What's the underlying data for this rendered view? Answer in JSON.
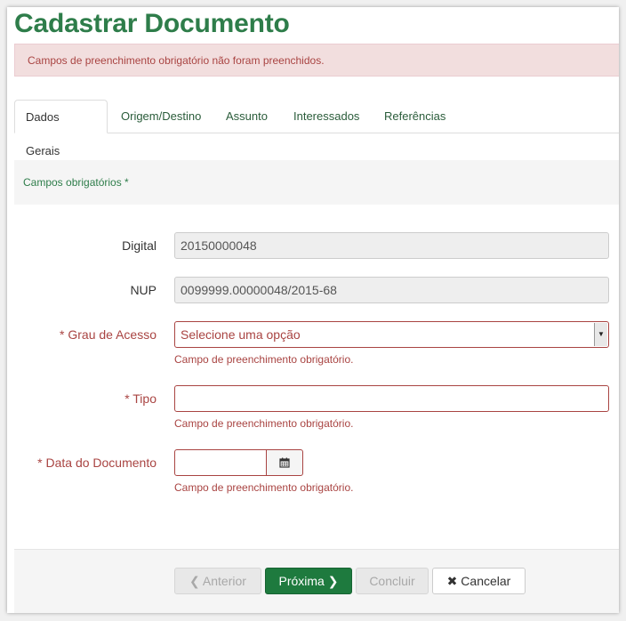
{
  "page": {
    "title": "Cadastrar Documento",
    "alert": "Campos de preenchimento obrigatório não foram preenchidos."
  },
  "tabs": [
    {
      "label": "Dados Gerais",
      "active": true
    },
    {
      "label": "Origem/Destino"
    },
    {
      "label": "Assunto"
    },
    {
      "label": "Interessados"
    },
    {
      "label": "Referências"
    }
  ],
  "panel": {
    "required_note": "Campos obrigatórios *"
  },
  "form": {
    "digital": {
      "label": "Digital",
      "value": "20150000048"
    },
    "nup": {
      "label": "NUP",
      "value": "0099999.00000048/2015-68"
    },
    "grau_acesso": {
      "label": "* Grau de Acesso",
      "selected": "Selecione uma opção",
      "error": "Campo de preenchimento obrigatório."
    },
    "tipo": {
      "label": "* Tipo",
      "value": "",
      "error": "Campo de preenchimento obrigatório."
    },
    "data_documento": {
      "label": "* Data do Documento",
      "value": "",
      "error": "Campo de preenchimento obrigatório."
    }
  },
  "footer": {
    "anterior": "Anterior",
    "proxima": "Próxima",
    "concluir": "Concluir",
    "cancelar": "Cancelar"
  },
  "icons": {
    "anterior": "chevron-left-icon",
    "proxima": "chevron-right-icon",
    "cancelar": "close-icon",
    "calendar": "calendar-icon"
  },
  "colors": {
    "brand_green": "#2e7d4a",
    "primary_button": "#1e7a3e",
    "error": "#a94442",
    "alert_bg": "#f2dede"
  }
}
